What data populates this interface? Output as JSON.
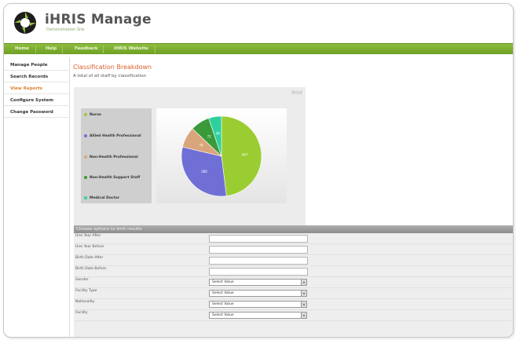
{
  "app": {
    "title": "iHRIS Manage",
    "subtitle": "Demonstration Site"
  },
  "nav": {
    "items": [
      {
        "label": "Home"
      },
      {
        "label": "Help"
      },
      {
        "label": "Feedback"
      },
      {
        "label": "iHRIS Website"
      }
    ]
  },
  "sidebar": {
    "items": [
      {
        "label": "Manage People",
        "active": false
      },
      {
        "label": "Search Records",
        "active": false
      },
      {
        "label": "View Reports",
        "active": true
      },
      {
        "label": "Configure System",
        "active": false
      },
      {
        "label": "Change Password",
        "active": false
      }
    ]
  },
  "page": {
    "title": "Classification Breakdown",
    "description": "A total of all staff by classification",
    "print_label": "Print"
  },
  "chart_data": {
    "type": "pie",
    "categories": [
      "Nurse",
      "Allied Health Professional",
      "Non-Health Professional",
      "Non-Health Support Staff",
      "Medical Doctor"
    ],
    "values": [
      447,
      286,
      78,
      72,
      48
    ],
    "colors": [
      "#9acd32",
      "#6f6fd6",
      "#d9a57a",
      "#3a9a3a",
      "#2fd0a0"
    ]
  },
  "options": {
    "header": "Choose options to limit results",
    "fields": [
      {
        "label": "Hire Year After",
        "kind": "text",
        "value": ""
      },
      {
        "label": "Hire Year Before",
        "kind": "text",
        "value": ""
      },
      {
        "label": "Birth Date After",
        "kind": "text",
        "value": ""
      },
      {
        "label": "Birth Date Before",
        "kind": "text",
        "value": ""
      },
      {
        "label": "Gender",
        "kind": "select",
        "value": "Select Value"
      },
      {
        "label": "Facility Type",
        "kind": "select",
        "value": "Select Value"
      },
      {
        "label": "Nationality",
        "kind": "select",
        "value": "Select Value"
      },
      {
        "label": "Facility",
        "kind": "select",
        "value": "Select Value"
      }
    ]
  }
}
